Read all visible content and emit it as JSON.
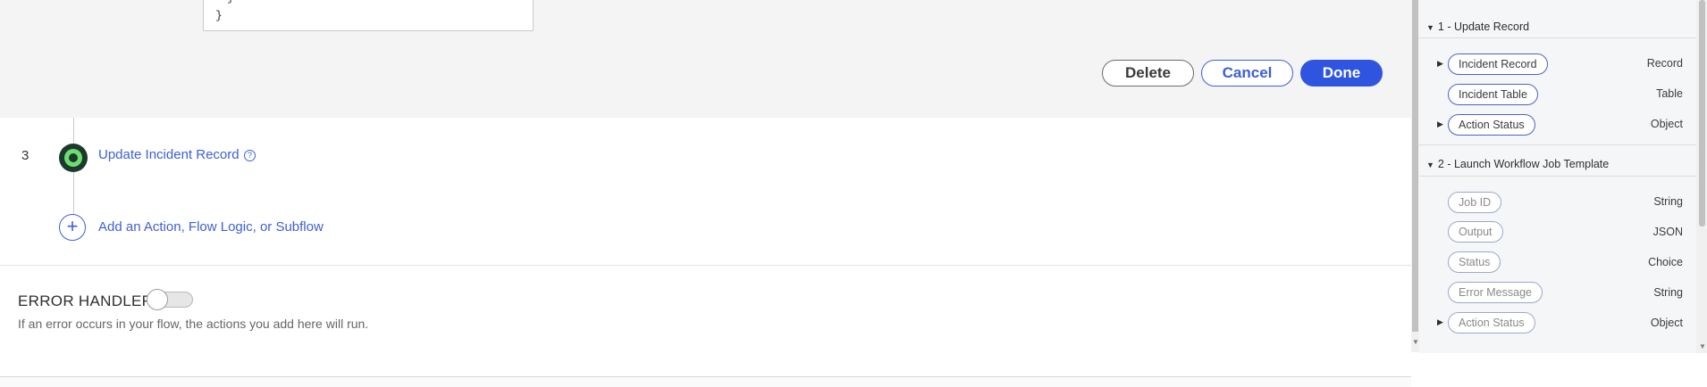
{
  "code_box": {
    "line1": "}",
    "line2": "}"
  },
  "buttons": {
    "delete": "Delete",
    "cancel": "Cancel",
    "done": "Done"
  },
  "step": {
    "number": "3",
    "title": "Update Incident Record",
    "help_icon": "help-icon",
    "status_icon": "action-status-icon"
  },
  "add_action": {
    "label": "Add an Action, Flow Logic, or Subflow",
    "icon": "plus-icon"
  },
  "error_handler": {
    "label": "ERROR HANDLER",
    "enabled": false,
    "description": "If an error occurs in your flow, the actions you add here will run."
  },
  "data_panel": {
    "groups": [
      {
        "title": "1 - Update Record",
        "expanded": true,
        "items": [
          {
            "label": "Incident Record",
            "type": "Record",
            "expandable": true
          },
          {
            "label": "Incident Table",
            "type": "Table",
            "expandable": false
          },
          {
            "label": "Action Status",
            "type": "Object",
            "expandable": true
          }
        ]
      },
      {
        "title": "2 - Launch Workflow Job Template",
        "expanded": true,
        "items": [
          {
            "label": "Job ID",
            "type": "String",
            "expandable": false
          },
          {
            "label": "Output",
            "type": "JSON",
            "expandable": false
          },
          {
            "label": "Status",
            "type": "Choice",
            "expandable": false
          },
          {
            "label": "Error Message",
            "type": "String",
            "expandable": false
          },
          {
            "label": "Action Status",
            "type": "Object",
            "expandable": true
          }
        ]
      }
    ]
  },
  "colors": {
    "accent": "#2f55e0",
    "link": "#3c5fd8",
    "status_green": "#6fdc73"
  }
}
